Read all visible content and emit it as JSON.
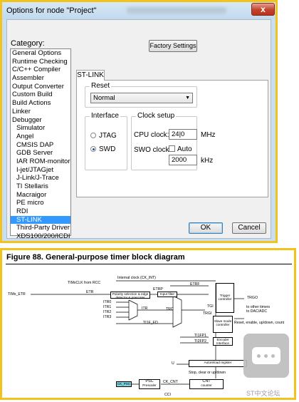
{
  "dialog": {
    "title": "Options for node \"Project\"",
    "close_glyph": "x",
    "category_label": "Category:",
    "categories": [
      {
        "label": "General Options",
        "indent": false,
        "selected": false
      },
      {
        "label": "Runtime Checking",
        "indent": false,
        "selected": false
      },
      {
        "label": "C/C++ Compiler",
        "indent": false,
        "selected": false
      },
      {
        "label": "Assembler",
        "indent": false,
        "selected": false
      },
      {
        "label": "Output Converter",
        "indent": false,
        "selected": false
      },
      {
        "label": "Custom Build",
        "indent": false,
        "selected": false
      },
      {
        "label": "Build Actions",
        "indent": false,
        "selected": false
      },
      {
        "label": "Linker",
        "indent": false,
        "selected": false
      },
      {
        "label": "Debugger",
        "indent": false,
        "selected": false
      },
      {
        "label": "Simulator",
        "indent": true,
        "selected": false
      },
      {
        "label": "Angel",
        "indent": true,
        "selected": false
      },
      {
        "label": "CMSIS DAP",
        "indent": true,
        "selected": false
      },
      {
        "label": "GDB Server",
        "indent": true,
        "selected": false
      },
      {
        "label": "IAR ROM-monitor",
        "indent": true,
        "selected": false
      },
      {
        "label": "I-jet/JTAGjet",
        "indent": true,
        "selected": false
      },
      {
        "label": "J-Link/J-Trace",
        "indent": true,
        "selected": false
      },
      {
        "label": "TI Stellaris",
        "indent": true,
        "selected": false
      },
      {
        "label": "Macraigor",
        "indent": true,
        "selected": false
      },
      {
        "label": "PE micro",
        "indent": true,
        "selected": false
      },
      {
        "label": "RDI",
        "indent": true,
        "selected": false
      },
      {
        "label": "ST-LINK",
        "indent": true,
        "selected": true
      },
      {
        "label": "Third-Party Driver",
        "indent": true,
        "selected": false
      },
      {
        "label": "XDS100/200/ICDI",
        "indent": true,
        "selected": false
      }
    ],
    "factory_settings_label": "Factory Settings",
    "tab_label": "ST-LINK",
    "reset": {
      "group_label": "Reset",
      "value": "Normal"
    },
    "interface": {
      "group_label": "Interface",
      "options": [
        {
          "label": "JTAG",
          "checked": false
        },
        {
          "label": "SWD",
          "checked": true
        }
      ]
    },
    "clock_setup": {
      "group_label": "Clock setup",
      "cpu_clock_label": "CPU clock:",
      "cpu_clock_value": "24|0",
      "cpu_clock_unit": "MHz",
      "swo_clock_label": "SWO clock:",
      "auto_label": "Auto",
      "auto_checked": false,
      "swo_clock_value": "2000",
      "swo_clock_unit": "kHz"
    },
    "ok_label": "OK",
    "cancel_label": "Cancel"
  },
  "figure": {
    "title": "Figure 88.   General-purpose timer block diagram",
    "labels": {
      "internal_clock": "Internal clock (CK_INT)",
      "timxclk": "TIMxCLK from RCC",
      "timx_etr": "TIMx_ETR",
      "etr": "ETR",
      "etrp": "ETRP",
      "etrf": "ETRF",
      "polarity": "Polarity selection & edge detector & prescaler",
      "input_filter": "Input filter",
      "itr0": "ITR0",
      "itr1": "ITR1",
      "itr2": "ITR2",
      "itr3": "ITR3",
      "itr": "ITR",
      "ti1f_ed": "TI1F_ED",
      "trc": "TRC",
      "tgi": "TGI",
      "trgi": "TRGI",
      "trigger_controller": "Trigger controller",
      "trgo": "TRGO",
      "to_other_timers": "to other timers",
      "to_dac_adc": "to DAC/ADC",
      "slave_mode_controller": "Slave mode controller",
      "reset_enable": "Reset, enable, up/down, count",
      "ti1fp1": "TI1FP1",
      "ti2fp2": "TI2FP2",
      "encoder_interface": "Encoder Interface",
      "u": "U",
      "autoreload": "Autoreload register",
      "stop_clear": "Stop, clear or up/down",
      "ck_psc": "CK_PSC",
      "psc": "PSC",
      "prescaler": "Prescaler",
      "ck_cnt": "CK_CNT",
      "cnt": "CNT",
      "counter": "counter",
      "ccu": "CCI"
    },
    "watermark": "ST中文论坛"
  }
}
